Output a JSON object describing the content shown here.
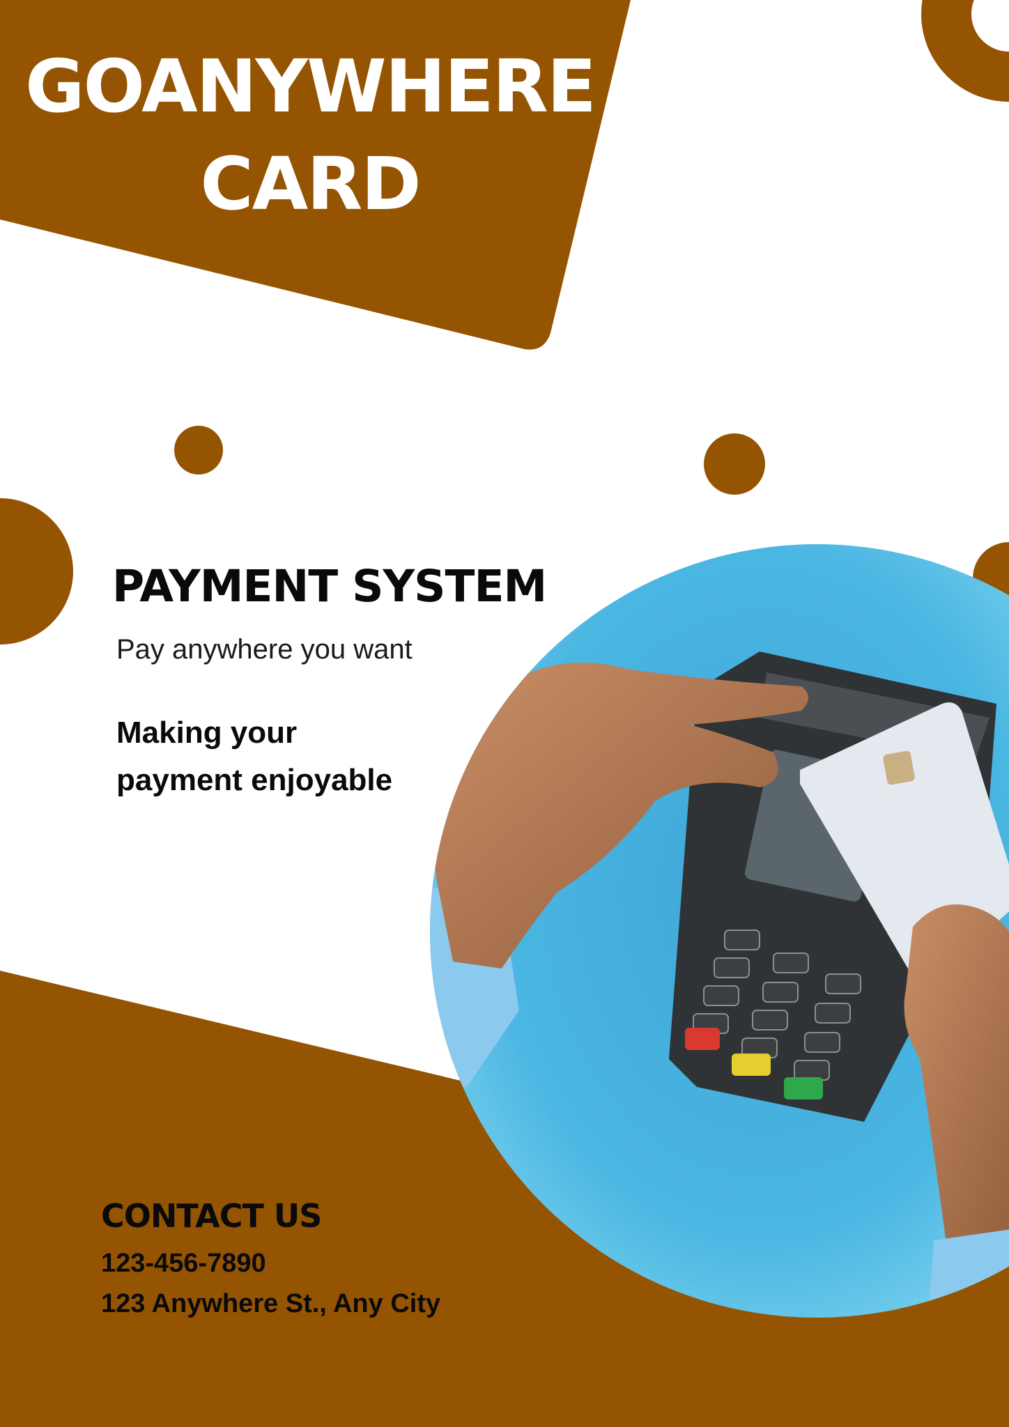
{
  "colors": {
    "accent": "#955402",
    "background": "#ffffff",
    "photo_blue": "#4bb7e0"
  },
  "header": {
    "title_line1": "GOANYWHERE",
    "title_line2": "CARD"
  },
  "hero": {
    "heading": "PAYMENT SYSTEM",
    "subheading": "Pay anywhere you want",
    "tagline_line1": "Making your",
    "tagline_line2": "payment enjoyable"
  },
  "contact": {
    "title": "CONTACT US",
    "phone": "123-456-7890",
    "address": "123 Anywhere St., Any City"
  }
}
